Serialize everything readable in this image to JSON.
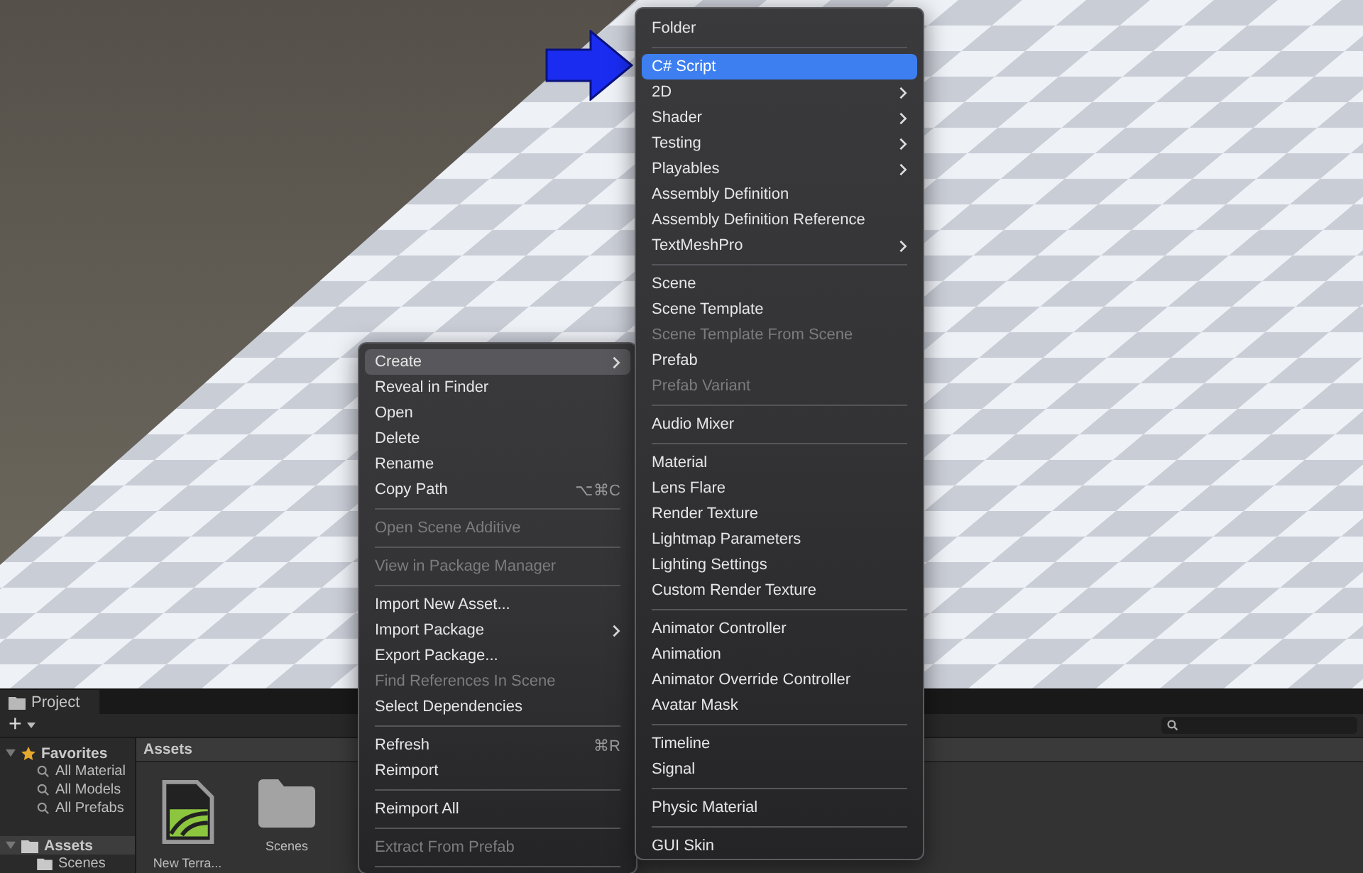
{
  "context_menu": {
    "focused": false,
    "items": [
      {
        "kind": "item",
        "label": "Create",
        "selected": true,
        "disabled": false,
        "submenu": true
      },
      {
        "kind": "item",
        "label": "Reveal in Finder",
        "selected": false,
        "disabled": false,
        "submenu": false
      },
      {
        "kind": "item",
        "label": "Open",
        "selected": false,
        "disabled": false,
        "submenu": false
      },
      {
        "kind": "item",
        "label": "Delete",
        "selected": false,
        "disabled": false,
        "submenu": false
      },
      {
        "kind": "item",
        "label": "Rename",
        "selected": false,
        "disabled": false,
        "submenu": false
      },
      {
        "kind": "item",
        "label": "Copy Path",
        "shortcut": "⌥⌘C",
        "selected": false,
        "disabled": false,
        "submenu": false
      },
      {
        "kind": "separator"
      },
      {
        "kind": "item",
        "label": "Open Scene Additive",
        "selected": false,
        "disabled": true,
        "submenu": false
      },
      {
        "kind": "separator"
      },
      {
        "kind": "item",
        "label": "View in Package Manager",
        "selected": false,
        "disabled": true,
        "submenu": false
      },
      {
        "kind": "separator"
      },
      {
        "kind": "item",
        "label": "Import New Asset...",
        "selected": false,
        "disabled": false,
        "submenu": false
      },
      {
        "kind": "item",
        "label": "Import Package",
        "selected": false,
        "disabled": false,
        "submenu": true
      },
      {
        "kind": "item",
        "label": "Export Package...",
        "selected": false,
        "disabled": false,
        "submenu": false
      },
      {
        "kind": "item",
        "label": "Find References In Scene",
        "selected": false,
        "disabled": true,
        "submenu": false
      },
      {
        "kind": "item",
        "label": "Select Dependencies",
        "selected": false,
        "disabled": false,
        "submenu": false
      },
      {
        "kind": "separator"
      },
      {
        "kind": "item",
        "label": "Refresh",
        "shortcut": "⌘R",
        "selected": false,
        "disabled": false,
        "submenu": false
      },
      {
        "kind": "item",
        "label": "Reimport",
        "selected": false,
        "disabled": false,
        "submenu": false
      },
      {
        "kind": "separator"
      },
      {
        "kind": "item",
        "label": "Reimport All",
        "selected": false,
        "disabled": false,
        "submenu": false
      },
      {
        "kind": "separator"
      },
      {
        "kind": "item",
        "label": "Extract From Prefab",
        "selected": false,
        "disabled": true,
        "submenu": false
      },
      {
        "kind": "separator"
      }
    ]
  },
  "create_submenu": {
    "focused": true,
    "items": [
      {
        "kind": "item",
        "label": "Folder",
        "selected": false,
        "disabled": false,
        "submenu": false
      },
      {
        "kind": "separator"
      },
      {
        "kind": "item",
        "label": "C# Script",
        "selected": true,
        "disabled": false,
        "submenu": false
      },
      {
        "kind": "item",
        "label": "2D",
        "selected": false,
        "disabled": false,
        "submenu": true
      },
      {
        "kind": "item",
        "label": "Shader",
        "selected": false,
        "disabled": false,
        "submenu": true
      },
      {
        "kind": "item",
        "label": "Testing",
        "selected": false,
        "disabled": false,
        "submenu": true
      },
      {
        "kind": "item",
        "label": "Playables",
        "selected": false,
        "disabled": false,
        "submenu": true
      },
      {
        "kind": "item",
        "label": "Assembly Definition",
        "selected": false,
        "disabled": false,
        "submenu": false
      },
      {
        "kind": "item",
        "label": "Assembly Definition Reference",
        "selected": false,
        "disabled": false,
        "submenu": false
      },
      {
        "kind": "item",
        "label": "TextMeshPro",
        "selected": false,
        "disabled": false,
        "submenu": true
      },
      {
        "kind": "separator"
      },
      {
        "kind": "item",
        "label": "Scene",
        "selected": false,
        "disabled": false,
        "submenu": false
      },
      {
        "kind": "item",
        "label": "Scene Template",
        "selected": false,
        "disabled": false,
        "submenu": false
      },
      {
        "kind": "item",
        "label": "Scene Template From Scene",
        "selected": false,
        "disabled": true,
        "submenu": false
      },
      {
        "kind": "item",
        "label": "Prefab",
        "selected": false,
        "disabled": false,
        "submenu": false
      },
      {
        "kind": "item",
        "label": "Prefab Variant",
        "selected": false,
        "disabled": true,
        "submenu": false
      },
      {
        "kind": "separator"
      },
      {
        "kind": "item",
        "label": "Audio Mixer",
        "selected": false,
        "disabled": false,
        "submenu": false
      },
      {
        "kind": "separator"
      },
      {
        "kind": "item",
        "label": "Material",
        "selected": false,
        "disabled": false,
        "submenu": false
      },
      {
        "kind": "item",
        "label": "Lens Flare",
        "selected": false,
        "disabled": false,
        "submenu": false
      },
      {
        "kind": "item",
        "label": "Render Texture",
        "selected": false,
        "disabled": false,
        "submenu": false
      },
      {
        "kind": "item",
        "label": "Lightmap Parameters",
        "selected": false,
        "disabled": false,
        "submenu": false
      },
      {
        "kind": "item",
        "label": "Lighting Settings",
        "selected": false,
        "disabled": false,
        "submenu": false
      },
      {
        "kind": "item",
        "label": "Custom Render Texture",
        "selected": false,
        "disabled": false,
        "submenu": false
      },
      {
        "kind": "separator"
      },
      {
        "kind": "item",
        "label": "Animator Controller",
        "selected": false,
        "disabled": false,
        "submenu": false
      },
      {
        "kind": "item",
        "label": "Animation",
        "selected": false,
        "disabled": false,
        "submenu": false
      },
      {
        "kind": "item",
        "label": "Animator Override Controller",
        "selected": false,
        "disabled": false,
        "submenu": false
      },
      {
        "kind": "item",
        "label": "Avatar Mask",
        "selected": false,
        "disabled": false,
        "submenu": false
      },
      {
        "kind": "separator"
      },
      {
        "kind": "item",
        "label": "Timeline",
        "selected": false,
        "disabled": false,
        "submenu": false
      },
      {
        "kind": "item",
        "label": "Signal",
        "selected": false,
        "disabled": false,
        "submenu": false
      },
      {
        "kind": "separator"
      },
      {
        "kind": "item",
        "label": "Physic Material",
        "selected": false,
        "disabled": false,
        "submenu": false
      },
      {
        "kind": "separator"
      },
      {
        "kind": "item",
        "label": "GUI Skin",
        "selected": false,
        "disabled": false,
        "submenu": false
      }
    ]
  },
  "project_panel": {
    "tab": "Project",
    "add_button": "+",
    "sidebar": [
      {
        "label": "Favorites",
        "kind": "favorites",
        "expanded": true,
        "selected": false,
        "children": [
          {
            "label": "All Material",
            "kind": "search",
            "selected": false
          },
          {
            "label": "All Models",
            "kind": "search",
            "selected": false
          },
          {
            "label": "All Prefabs",
            "kind": "search",
            "selected": false
          }
        ]
      },
      {
        "label": "Assets",
        "kind": "folder",
        "expanded": true,
        "selected": true,
        "children": [
          {
            "label": "Scenes",
            "kind": "folder",
            "selected": false
          }
        ]
      }
    ],
    "breadcrumb": "Assets",
    "assets": [
      {
        "label": "New Terra...",
        "kind": "terrain"
      },
      {
        "label": "Scenes",
        "kind": "folder"
      }
    ]
  }
}
